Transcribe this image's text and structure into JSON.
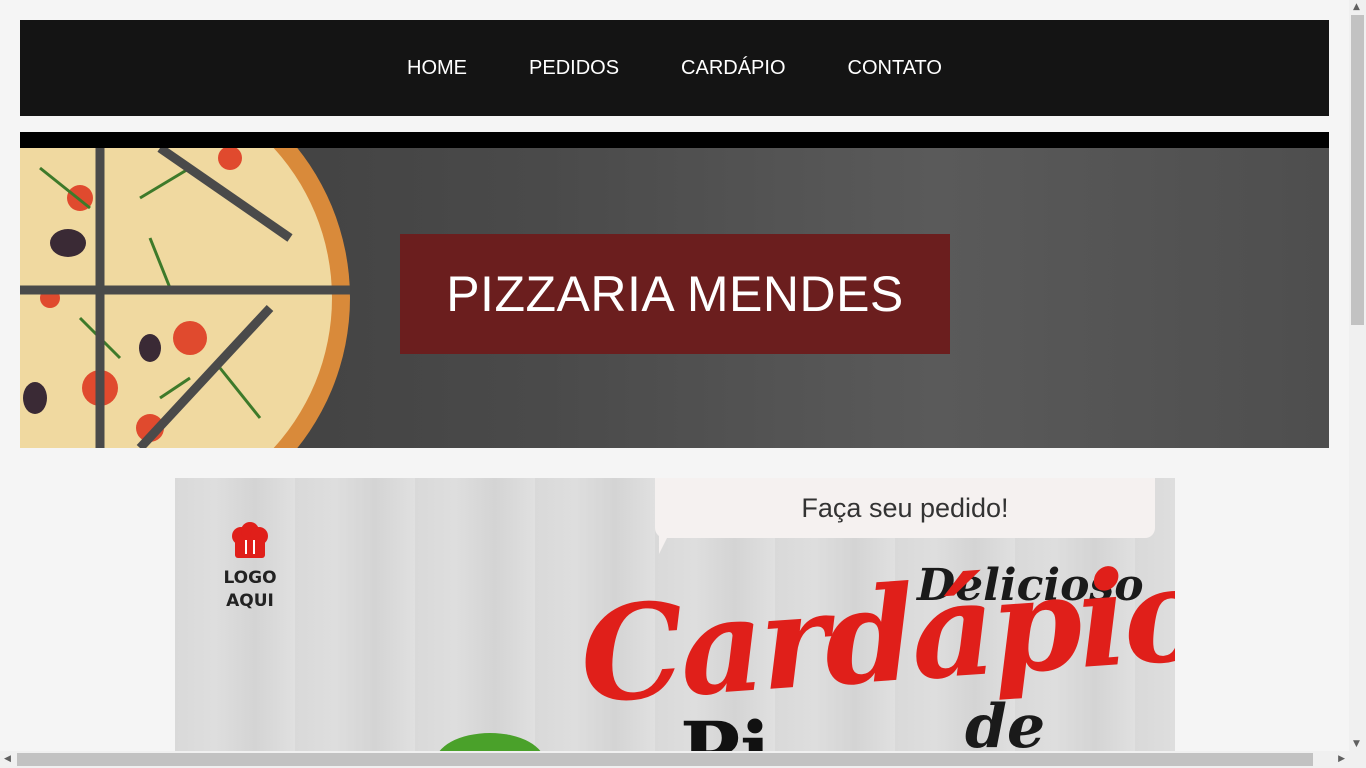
{
  "nav": {
    "items": [
      {
        "label": "HOME"
      },
      {
        "label": "PEDIDOS"
      },
      {
        "label": "CARDÁPIO"
      },
      {
        "label": "CONTATO"
      }
    ]
  },
  "hero": {
    "title": "PIZZARIA MENDES"
  },
  "menu_banner": {
    "bubble_text": "Faça seu pedido!",
    "logo_line1": "LOGO",
    "logo_line2": "AQUI",
    "heading_small": "Delicioso",
    "heading_big": "Cardápio",
    "heading_de": "de",
    "heading_partial": "Pi"
  },
  "colors": {
    "nav_bg": "#141414",
    "hero_title_bg": "#6b1e1e",
    "accent_red": "#e01f1a"
  }
}
